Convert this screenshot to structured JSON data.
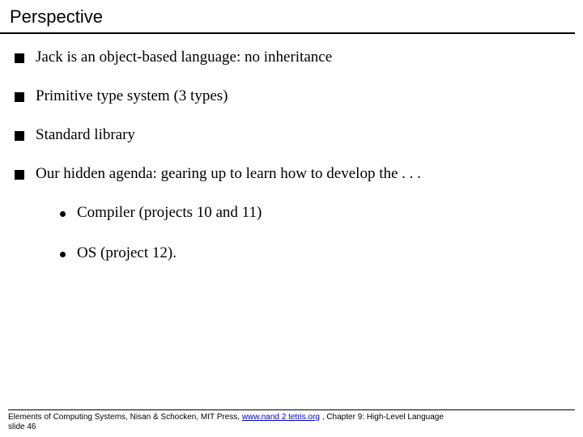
{
  "title": "Perspective",
  "bullets": [
    "Jack is an object-based language: no inheritance",
    "Primitive type system (3 types)",
    "Standard library",
    "Our hidden agenda: gearing up to learn how to develop the . . ."
  ],
  "sub_bullets": [
    "Compiler (projects 10 and 11)",
    "OS (project 12)."
  ],
  "footer": {
    "prefix": "Elements of Computing Systems, Nisan & Schocken, MIT Press, ",
    "link_text": "www.nand 2 tetris.org",
    "suffix": " , Chapter 9: High-Level Language",
    "slide_label": "slide 46"
  }
}
